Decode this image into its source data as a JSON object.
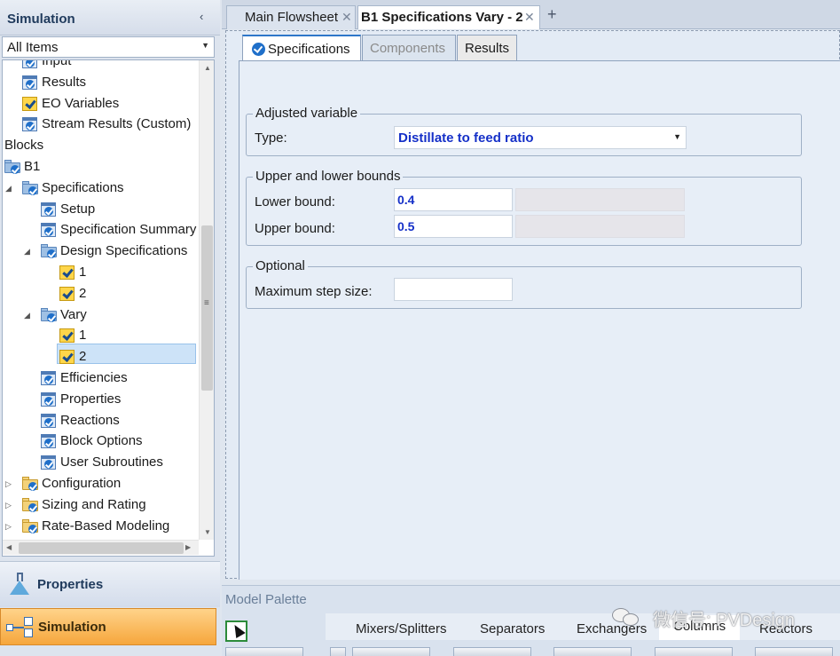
{
  "nav": {
    "title": "Simulation",
    "collapse_glyph": "‹",
    "filter_value": "All Items",
    "tree": [
      {
        "label": "Input",
        "icon": "form-icon",
        "level": 1,
        "expander": ""
      },
      {
        "label": "Results",
        "icon": "form-icon",
        "level": 1,
        "expander": ""
      },
      {
        "label": "EO Variables",
        "icon": "spec-check-icon",
        "level": 1,
        "expander": ""
      },
      {
        "label": "Stream Results (Custom)",
        "icon": "form-icon",
        "level": 1,
        "expander": ""
      },
      {
        "label": "Blocks",
        "icon": "",
        "level": 0,
        "expander": ""
      },
      {
        "label": "B1",
        "icon": "block-folder-icon",
        "level": 0,
        "expander": ""
      },
      {
        "label": "Specifications",
        "icon": "folder-check-icon",
        "level": 1,
        "expander": "◢"
      },
      {
        "label": "Setup",
        "icon": "form-icon",
        "level": 2,
        "expander": ""
      },
      {
        "label": "Specification Summary",
        "icon": "form-icon",
        "level": 2,
        "expander": ""
      },
      {
        "label": "Design Specifications",
        "icon": "folder-check-icon",
        "level": 2,
        "expander": "◢"
      },
      {
        "label": "1",
        "icon": "spec-check-icon",
        "level": 3,
        "expander": ""
      },
      {
        "label": "2",
        "icon": "spec-check-icon",
        "level": 3,
        "expander": ""
      },
      {
        "label": "Vary",
        "icon": "folder-check-icon",
        "level": 2,
        "expander": "◢"
      },
      {
        "label": "1",
        "icon": "spec-check-icon",
        "level": 3,
        "expander": ""
      },
      {
        "label": "2",
        "icon": "spec-check-icon",
        "level": 3,
        "expander": ""
      },
      {
        "label": "Efficiencies",
        "icon": "form-icon",
        "level": 2,
        "expander": ""
      },
      {
        "label": "Properties",
        "icon": "form-icon",
        "level": 2,
        "expander": ""
      },
      {
        "label": "Reactions",
        "icon": "form-icon",
        "level": 2,
        "expander": ""
      },
      {
        "label": "Block Options",
        "icon": "form-icon",
        "level": 2,
        "expander": ""
      },
      {
        "label": "User Subroutines",
        "icon": "form-icon",
        "level": 2,
        "expander": ""
      },
      {
        "label": "Configuration",
        "icon": "folder-yellow-icon",
        "level": 1,
        "expander": "▷"
      },
      {
        "label": "Sizing and Rating",
        "icon": "folder-yellow-icon",
        "level": 1,
        "expander": "▷"
      },
      {
        "label": "Rate-Based Modeling",
        "icon": "folder-yellow-icon",
        "level": 1,
        "expander": "▷"
      }
    ],
    "properties_label": "Properties",
    "simulation_label": "Simulation"
  },
  "doc_tabs": {
    "main_flowsheet": "Main Flowsheet",
    "vary_tab": "B1 Specifications Vary - 2",
    "close_glyph": "✕",
    "add_glyph": "+"
  },
  "inner_tabs": {
    "specifications": "Specifications",
    "components": "Components",
    "results": "Results"
  },
  "form": {
    "adjusted_variable": {
      "title": "Adjusted variable",
      "type_label": "Type:",
      "type_value": "Distillate to feed ratio"
    },
    "bounds": {
      "title": "Upper and lower bounds",
      "lower_label": "Lower bound:",
      "lower_value": "0.4",
      "upper_label": "Upper bound:",
      "upper_value": "0.5"
    },
    "optional": {
      "title": "Optional",
      "max_step_label": "Maximum step size:",
      "max_step_value": ""
    }
  },
  "palette": {
    "title": "Model Palette",
    "tabs": [
      "Mixers/Splitters",
      "Separators",
      "Exchangers",
      "Columns",
      "Reactors"
    ],
    "active_tab": "Columns"
  },
  "watermark": "微信号: PVDesign",
  "colors": {
    "value_text": "#1530c8",
    "selected_row": "#cde3f8",
    "simulation_button": "#f6a63c"
  }
}
